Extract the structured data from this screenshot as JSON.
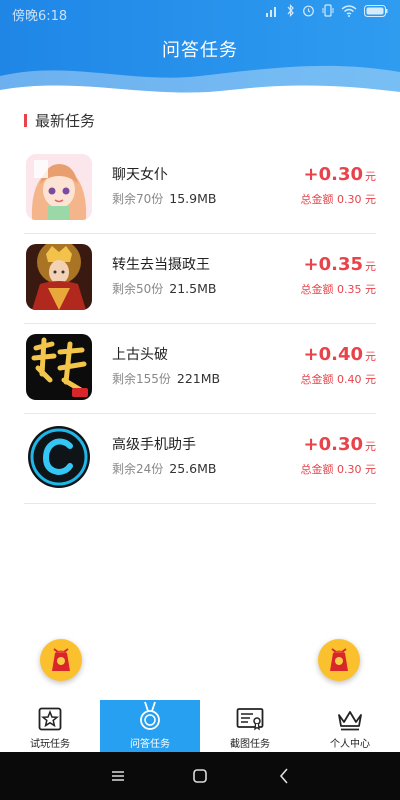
{
  "status": {
    "time": "傍晚6:18"
  },
  "header": {
    "title": "问答任务"
  },
  "section": {
    "title": "最新任务"
  },
  "tasks": [
    {
      "name": "聊天女仆",
      "remaining": "剩余70份",
      "size": "15.9MB",
      "reward": "+0.30",
      "unit": "元",
      "total": "总金额 0.30 元",
      "icon": "anime-girl-app-icon"
    },
    {
      "name": "转生去当摄政王",
      "remaining": "剩余50份",
      "size": "21.5MB",
      "reward": "+0.35",
      "unit": "元",
      "total": "总金额 0.35 元",
      "icon": "empress-app-icon"
    },
    {
      "name": "上古头破",
      "remaining": "剩余155份",
      "size": "221MB",
      "reward": "+0.40",
      "unit": "元",
      "total": "总金额 0.40 元",
      "icon": "doupo-app-icon"
    },
    {
      "name": "高级手机助手",
      "remaining": "剩余24份",
      "size": "25.6MB",
      "reward": "+0.30",
      "unit": "元",
      "total": "总金额 0.30 元",
      "icon": "c-ring-app-icon"
    }
  ],
  "tabs": [
    {
      "label": "试玩任务",
      "icon": "star-box-icon"
    },
    {
      "label": "问答任务",
      "icon": "medal-icon"
    },
    {
      "label": "截图任务",
      "icon": "certificate-icon"
    },
    {
      "label": "个人中心",
      "icon": "crown-icon"
    }
  ],
  "colors": {
    "primary": "#27a0f1",
    "accent": "#e8434a"
  }
}
